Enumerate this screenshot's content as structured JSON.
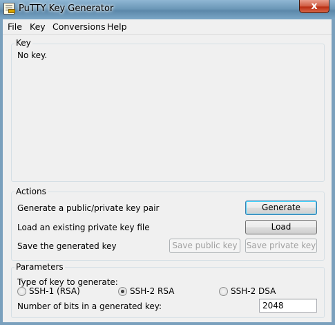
{
  "window": {
    "title": "PuTTY Key Generator",
    "close_glyph": "x"
  },
  "menu": [
    "File",
    "Key",
    "Conversions",
    "Help"
  ],
  "key_group": {
    "label": "Key",
    "text": "No key."
  },
  "actions": {
    "label": "Actions",
    "generate_text": "Generate a public/private key pair",
    "generate_button": "Generate",
    "load_text": "Load an existing private key file",
    "load_button": "Load",
    "save_text": "Save the generated key",
    "save_public_button": "Save public key",
    "save_private_button": "Save private key"
  },
  "parameters": {
    "label": "Parameters",
    "type_label": "Type of key to generate:",
    "options": [
      "SSH-1 (RSA)",
      "SSH-2 RSA",
      "SSH-2 DSA"
    ],
    "selected_option": "SSH-2 RSA",
    "bits_label": "Number of bits in a generated key:",
    "bits_value": "2048"
  }
}
